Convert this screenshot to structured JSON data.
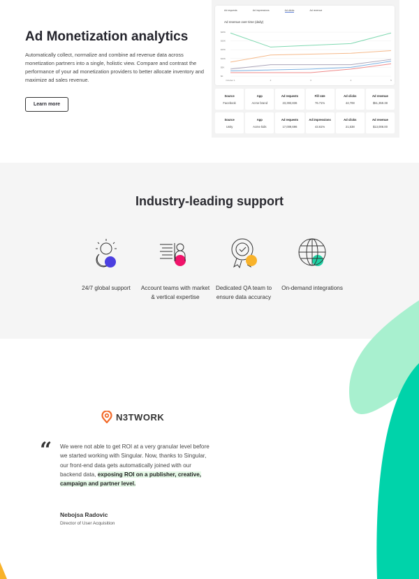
{
  "hero": {
    "title": "Ad Monetization analytics",
    "description": "Automatically collect, normalize and combine ad revenue data across monetization partners into a single, holistic view. Compare and contrast the performance of your ad monetization providers to better allocate inventory and maximize ad sales revenue.",
    "cta": "Learn more"
  },
  "mockup": {
    "tabs": [
      "Ad requests",
      "Ad impressions",
      "Ad clicks",
      "Ad revenue"
    ],
    "active_tab": "Ad clicks",
    "rows": [
      {
        "cells": [
          [
            "Source",
            "Facebook"
          ],
          [
            "App",
            "Acme brand"
          ],
          [
            "Ad requests",
            "23,393,836"
          ],
          [
            "Fill rate",
            "76.71%"
          ],
          [
            "Ad clicks",
            "44,708"
          ],
          [
            "Ad revenue",
            "$51,359.38"
          ]
        ]
      },
      {
        "cells": [
          [
            "Source",
            "Unity"
          ],
          [
            "App",
            "Acme kids"
          ],
          [
            "Ad requests",
            "17,009,696"
          ],
          [
            "Ad impressions",
            "43.61%"
          ],
          [
            "Ad clicks",
            "21,538"
          ],
          [
            "Ad revenue",
            "$13,008.00"
          ]
        ]
      }
    ]
  },
  "chart_data": {
    "type": "line",
    "title": "Ad revenue over time (daily)",
    "x": [
      "October 1",
      "2",
      "3",
      "4",
      "5"
    ],
    "yticks": [
      "$0",
      "$5K",
      "$10K",
      "$15K",
      "$20K",
      "$25K"
    ],
    "ylim": [
      0,
      25000
    ],
    "series": [
      {
        "name": "green",
        "color": "#7fd8b0",
        "values": [
          24500,
          16500,
          17500,
          18500,
          24500
        ]
      },
      {
        "name": "orange",
        "color": "#f5b98a",
        "values": [
          8000,
          12000,
          12500,
          13000,
          14500
        ]
      },
      {
        "name": "gray",
        "color": "#a9a3b8",
        "values": [
          4000,
          6500,
          6500,
          6500,
          9500
        ]
      },
      {
        "name": "blue",
        "color": "#7ab0e0",
        "values": [
          3000,
          3500,
          4000,
          5000,
          8500
        ]
      },
      {
        "name": "red",
        "color": "#ef8a8a",
        "values": [
          2000,
          2000,
          2000,
          4000,
          7000
        ]
      }
    ]
  },
  "support": {
    "title": "Industry-leading support",
    "features": [
      {
        "label": "24/7 global support",
        "icon": "sun-moon-icon",
        "color": "#4b3fe0"
      },
      {
        "label": "Account teams with market & vertical expertise",
        "icon": "account-team-icon",
        "color": "#f0136a"
      },
      {
        "label": "Dedicated QA team to ensure data accuracy",
        "icon": "award-badge-icon",
        "color": "#f8b22a"
      },
      {
        "label": "On-demand integrations",
        "icon": "globe-icon",
        "color": "#1ed1a4"
      }
    ]
  },
  "testimonial": {
    "brand": "N3TWORK",
    "quote": "We were not able to get ROI at a very granular level before we started working with Singular. Now, thanks to Singular, our front-end data gets automatically joined with our backend data,",
    "highlight": "exposing ROI on a publisher, creative, campaign and partner level.",
    "author": "Nebojsa Radovic",
    "role": "Director of User Acquisition"
  }
}
